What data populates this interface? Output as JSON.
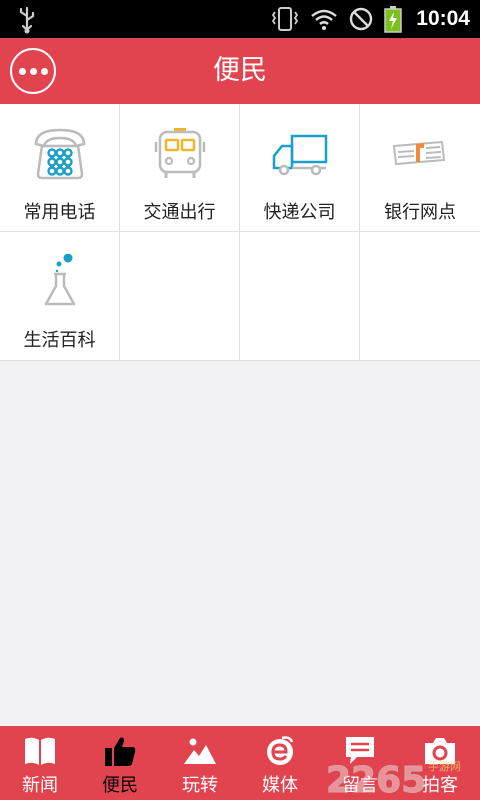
{
  "status_bar": {
    "time": "10:04"
  },
  "header": {
    "title": "便民"
  },
  "grid": {
    "items": [
      {
        "label": "常用电话",
        "icon": "telephone-icon"
      },
      {
        "label": "交通出行",
        "icon": "bus-icon"
      },
      {
        "label": "快递公司",
        "icon": "truck-icon"
      },
      {
        "label": "银行网点",
        "icon": "banknotes-icon"
      },
      {
        "label": "生活百科",
        "icon": "flask-icon"
      }
    ]
  },
  "tabbar": {
    "tabs": [
      {
        "label": "新闻",
        "icon": "book-icon"
      },
      {
        "label": "便民",
        "icon": "thumbs-up-icon",
        "active": true
      },
      {
        "label": "玩转",
        "icon": "mountain-icon"
      },
      {
        "label": "媒体",
        "icon": "e-media-icon"
      },
      {
        "label": "留言",
        "icon": "message-icon"
      },
      {
        "label": "拍客",
        "icon": "camera-icon"
      }
    ]
  },
  "colors": {
    "accent": "#e2444f",
    "icon_blue": "#1aa0c8",
    "icon_yellow": "#f0b52a",
    "icon_gray": "#bbbbbb",
    "icon_orange": "#f08a3c"
  }
}
